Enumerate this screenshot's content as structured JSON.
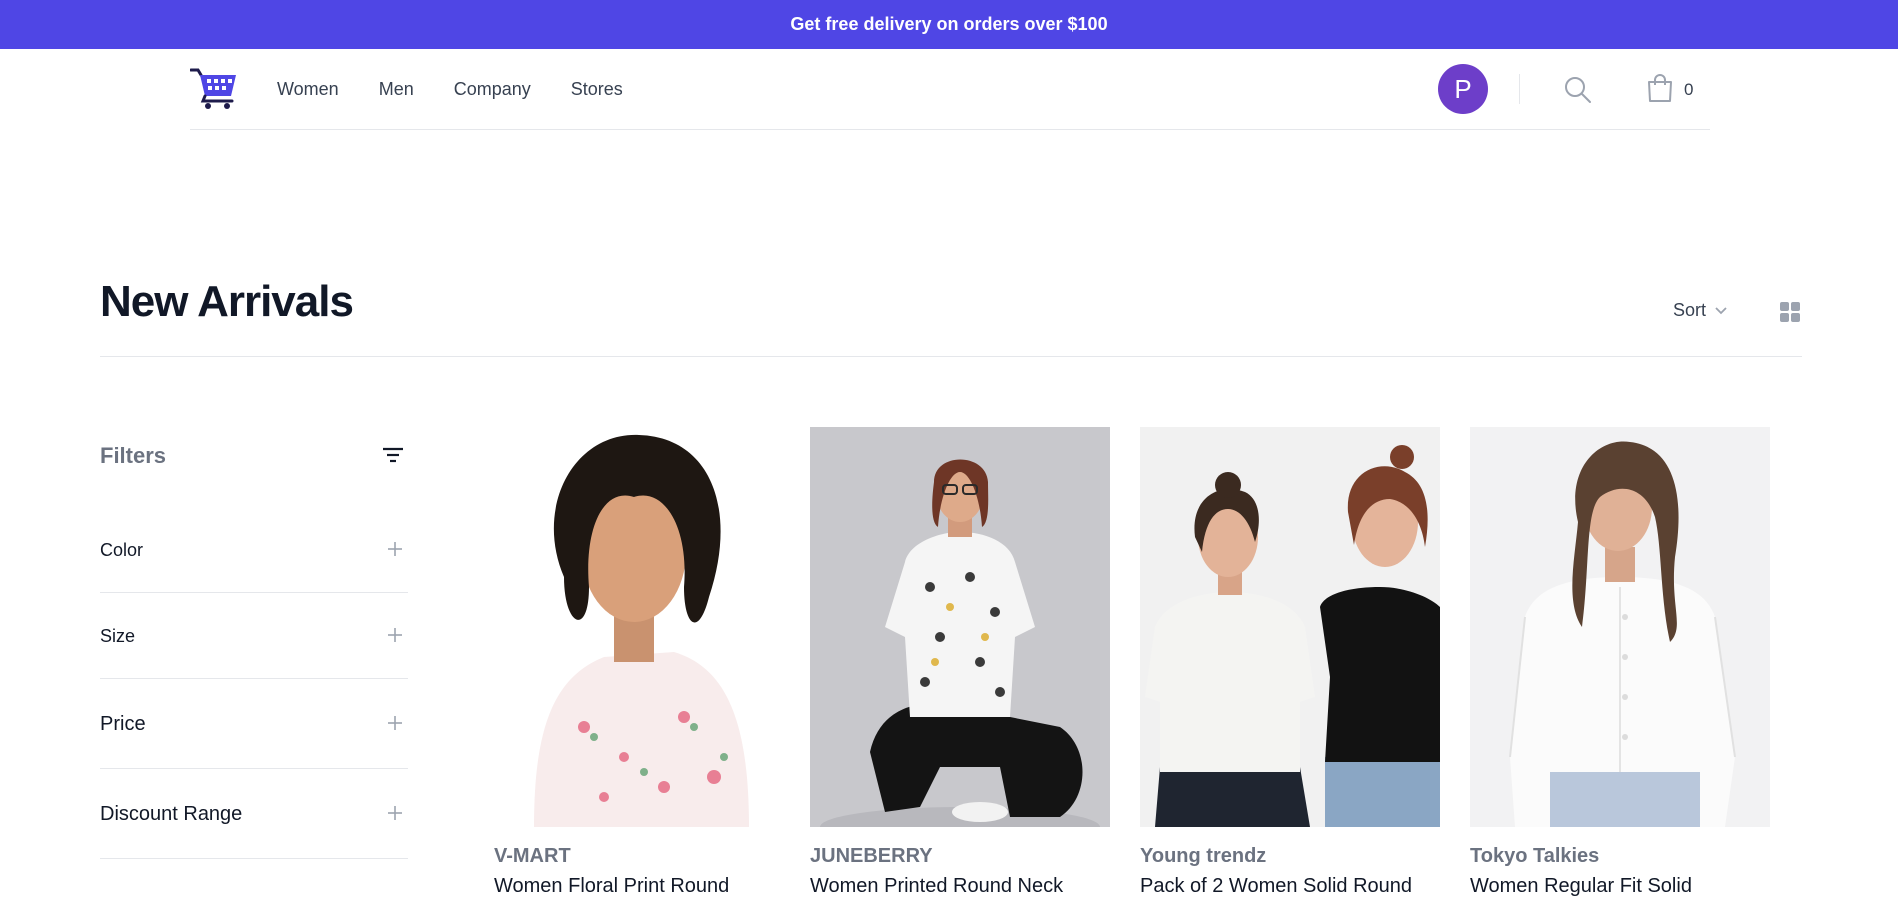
{
  "colors": {
    "accent": "#4f46e5",
    "avatar_bg": "#6d3ec9"
  },
  "promo": {
    "text": "Get free delivery on orders over $100"
  },
  "nav": {
    "logo_icon": "shopping-cart-logo-icon",
    "links": [
      "Women",
      "Men",
      "Company",
      "Stores"
    ],
    "avatar_initial": "P",
    "search_icon": "search-icon",
    "cart_icon": "shopping-bag-icon",
    "cart_count": "0"
  },
  "header": {
    "title": "New Arrivals",
    "sort_label": "Sort",
    "grid_icon": "grid-view-icon"
  },
  "filters": {
    "title": "Filters",
    "sections": [
      "Color",
      "Size",
      "Price",
      "Discount Range"
    ]
  },
  "products": [
    {
      "brand": "V-MART",
      "name": "Women Floral Print Round"
    },
    {
      "brand": "JUNEBERRY",
      "name": "Women Printed Round Neck"
    },
    {
      "brand": "Young trendz",
      "name": "Pack of 2 Women Solid Round"
    },
    {
      "brand": "Tokyo Talkies",
      "name": "Women Regular Fit Solid"
    }
  ]
}
